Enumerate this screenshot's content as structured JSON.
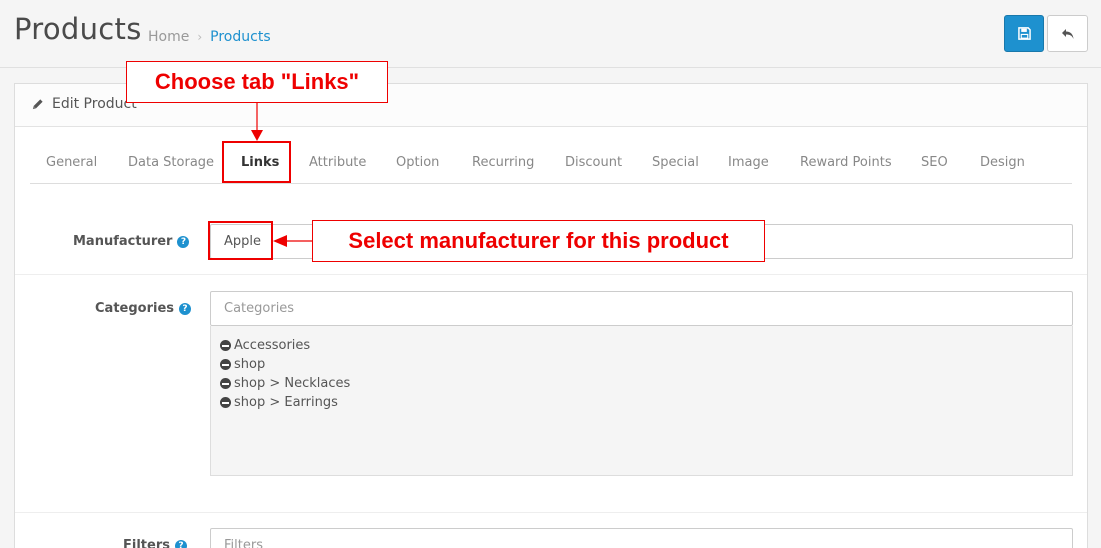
{
  "header": {
    "title": "Products",
    "breadcrumb": {
      "home": "Home",
      "separator": "›",
      "current": "Products"
    }
  },
  "panel": {
    "title": "Edit Product"
  },
  "tabs": [
    {
      "label": "General"
    },
    {
      "label": "Data Storage"
    },
    {
      "label": "Links",
      "active": true
    },
    {
      "label": "Attribute"
    },
    {
      "label": "Option"
    },
    {
      "label": "Recurring"
    },
    {
      "label": "Discount"
    },
    {
      "label": "Special"
    },
    {
      "label": "Image"
    },
    {
      "label": "Reward Points"
    },
    {
      "label": "SEO"
    },
    {
      "label": "Design"
    }
  ],
  "form": {
    "manufacturer": {
      "label": "Manufacturer",
      "value": "Apple"
    },
    "categories": {
      "label": "Categories",
      "placeholder": "Categories",
      "items": [
        "Accessories",
        "shop",
        "shop > Necklaces",
        "shop > Earrings"
      ]
    },
    "filters": {
      "label": "Filters",
      "placeholder": "Filters"
    }
  },
  "annotations": {
    "tab_callout": "Choose tab \"Links\"",
    "manufacturer_callout": "Select manufacturer for this product"
  },
  "colors": {
    "accent": "#1e91cf",
    "annotation": "#e00000"
  }
}
